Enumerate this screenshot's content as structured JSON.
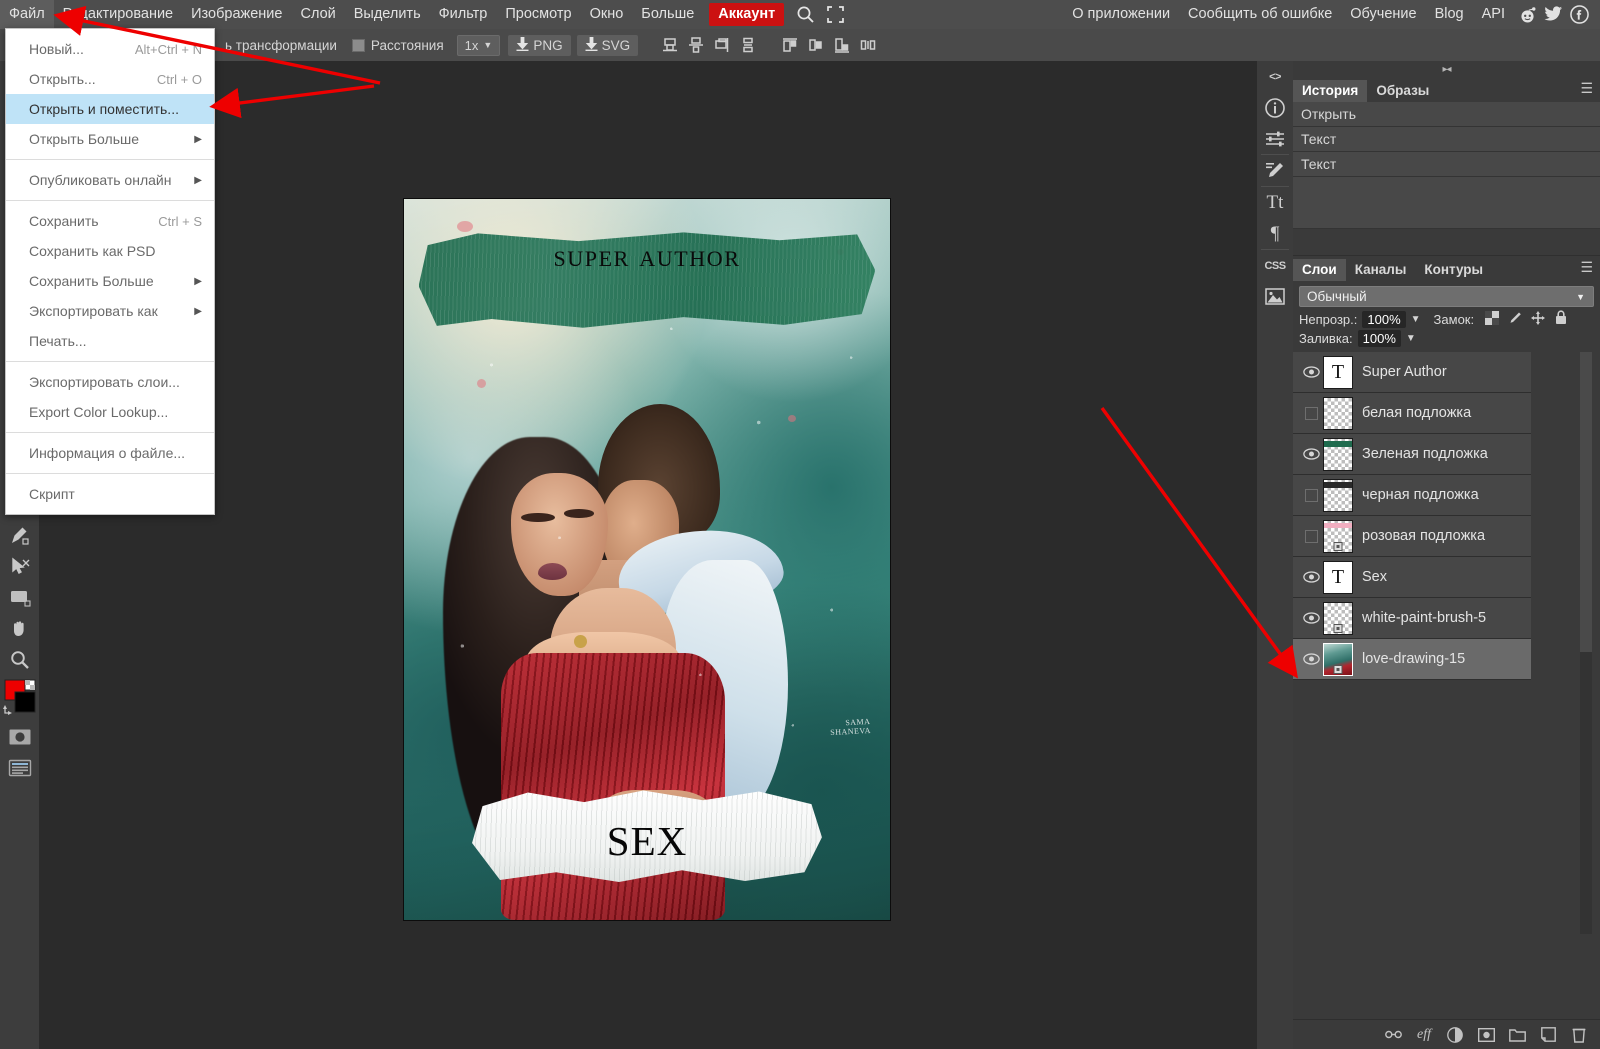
{
  "menubar": {
    "items": [
      {
        "label": "Файл"
      },
      {
        "label": "Редактирование"
      },
      {
        "label": "Изображение"
      },
      {
        "label": "Слой"
      },
      {
        "label": "Выделить"
      },
      {
        "label": "Фильтр"
      },
      {
        "label": "Просмотр"
      },
      {
        "label": "Окно"
      },
      {
        "label": "Больше"
      }
    ],
    "account_label": "Аккаунт",
    "account_color": "#cc1111",
    "search_icon": "search-icon",
    "fullscreen_icon": "fullscreen-icon",
    "right_items": [
      {
        "label": "О приложении"
      },
      {
        "label": "Сообщить об ошибке"
      },
      {
        "label": "Обучение"
      },
      {
        "label": "Blog"
      },
      {
        "label": "API"
      }
    ],
    "social": [
      {
        "icon": "reddit-icon"
      },
      {
        "icon": "twitter-icon"
      },
      {
        "icon": "facebook-icon"
      }
    ]
  },
  "optionsbar": {
    "transform_label": "ь трансформации",
    "distances_label": "Расстояния",
    "scale_value": "1x",
    "png_label": "PNG",
    "svg_label": "SVG",
    "align_icons": [
      "align-bottom-icon",
      "align-center-vertical-icon",
      "align-top-icon",
      "distribute-vertical-icon",
      "align-left-icon",
      "align-center-horizontal-icon",
      "align-right-icon",
      "distribute-horizontal-icon"
    ]
  },
  "filemenu": {
    "items": [
      {
        "label": "Новый...",
        "shortcut": "Alt+Ctrl + N",
        "submenu": false,
        "highlight": false
      },
      {
        "label": "Открыть...",
        "shortcut": "Ctrl + O",
        "submenu": false,
        "highlight": false
      },
      {
        "label": "Открыть и поместить...",
        "shortcut": "",
        "submenu": false,
        "highlight": true
      },
      {
        "label": "Открыть Больше",
        "shortcut": "",
        "submenu": true,
        "highlight": false
      },
      {
        "separator": true
      },
      {
        "label": "Опубликовать онлайн",
        "shortcut": "",
        "submenu": true,
        "highlight": false
      },
      {
        "separator": true
      },
      {
        "label": "Сохранить",
        "shortcut": "Ctrl + S",
        "submenu": false,
        "highlight": false
      },
      {
        "label": "Сохранить как PSD",
        "shortcut": "",
        "submenu": false,
        "highlight": false
      },
      {
        "label": "Сохранить Больше",
        "shortcut": "",
        "submenu": true,
        "highlight": false
      },
      {
        "label": "Экспортировать как",
        "shortcut": "",
        "submenu": true,
        "highlight": false
      },
      {
        "label": "Печать...",
        "shortcut": "",
        "submenu": false,
        "highlight": false
      },
      {
        "separator": true
      },
      {
        "label": "Экспортировать слои...",
        "shortcut": "",
        "submenu": false,
        "highlight": false
      },
      {
        "label": "Export Color Lookup...",
        "shortcut": "",
        "submenu": false,
        "highlight": false
      },
      {
        "separator": true
      },
      {
        "label": "Информация о файле...",
        "shortcut": "",
        "submenu": false,
        "highlight": false
      },
      {
        "separator": true
      },
      {
        "label": "Скрипт",
        "shortcut": "",
        "submenu": false,
        "highlight": false
      }
    ],
    "highlight_color": "#bfe3f7"
  },
  "lefttools": {
    "items": [
      {
        "icon": "text-tool-icon"
      },
      {
        "icon": "pen-tool-icon"
      },
      {
        "icon": "path-select-icon"
      },
      {
        "icon": "shape-rectangle-icon"
      },
      {
        "icon": "hand-tool-icon"
      },
      {
        "icon": "zoom-tool-icon"
      },
      {
        "icon": "color-swatches-icon"
      },
      {
        "icon": "quick-mask-icon"
      },
      {
        "icon": "screen-mode-icon"
      }
    ],
    "foreground_color": "#ee0000",
    "background_color": "#000000"
  },
  "canvas": {
    "cover_title": "Super Author",
    "cover_subtitle": "Sex",
    "signature_line1": "SAMA",
    "signature_line2": "SHANEVA"
  },
  "history": {
    "tabs": [
      {
        "label": "История",
        "active": true
      },
      {
        "label": "Образы",
        "active": false
      }
    ],
    "menu_icon": "panel-menu-icon",
    "collapse_icon": "collapse-icon",
    "entries": [
      {
        "label": "Открыть"
      },
      {
        "label": "Текст"
      },
      {
        "label": "Текст"
      }
    ]
  },
  "layers": {
    "tabs": [
      {
        "label": "Слои",
        "active": true
      },
      {
        "label": "Каналы",
        "active": false
      },
      {
        "label": "Контуры",
        "active": false
      }
    ],
    "menu_icon": "panel-menu-icon",
    "blend_mode": "Обычный",
    "opacity_label": "Непрозр.:",
    "opacity_value": "100%",
    "lock_label": "Замок:",
    "lock_icons": [
      "lock-transparency-icon",
      "lock-paint-icon",
      "lock-move-icon",
      "lock-all-icon"
    ],
    "fill_label": "Заливка:",
    "fill_value": "100%",
    "selected_highlight": "#6a6a6a",
    "items": [
      {
        "name": "Super Author",
        "visible": true,
        "type": "text",
        "selected": false
      },
      {
        "name": "белая подложка",
        "visible": false,
        "type": "raster",
        "selected": false
      },
      {
        "name": "Зеленая подложка",
        "visible": true,
        "type": "raster-green",
        "selected": false
      },
      {
        "name": "черная подложка",
        "visible": false,
        "type": "raster-dark",
        "selected": false
      },
      {
        "name": "розовая подложка",
        "visible": false,
        "type": "raster-pink",
        "selected": false
      },
      {
        "name": "Sex",
        "visible": true,
        "type": "text",
        "selected": false
      },
      {
        "name": "white-paint-brush-5",
        "visible": true,
        "type": "raster",
        "selected": false
      },
      {
        "name": "love-drawing-15",
        "visible": true,
        "type": "photo",
        "selected": true
      }
    ],
    "bottom_icons": [
      {
        "icon": "link-layers-icon"
      },
      {
        "icon": "layer-effects-icon"
      },
      {
        "icon": "adjustment-layer-icon"
      },
      {
        "icon": "layer-mask-icon"
      },
      {
        "icon": "new-group-icon"
      },
      {
        "icon": "new-layer-icon"
      },
      {
        "icon": "delete-layer-icon"
      }
    ]
  },
  "annotations": {
    "arrow_color": "#ee0000",
    "arrows": [
      {
        "name": "arrow-to-file-menu"
      },
      {
        "name": "arrow-to-open-and-place"
      },
      {
        "name": "arrow-to-selected-layer"
      }
    ]
  }
}
